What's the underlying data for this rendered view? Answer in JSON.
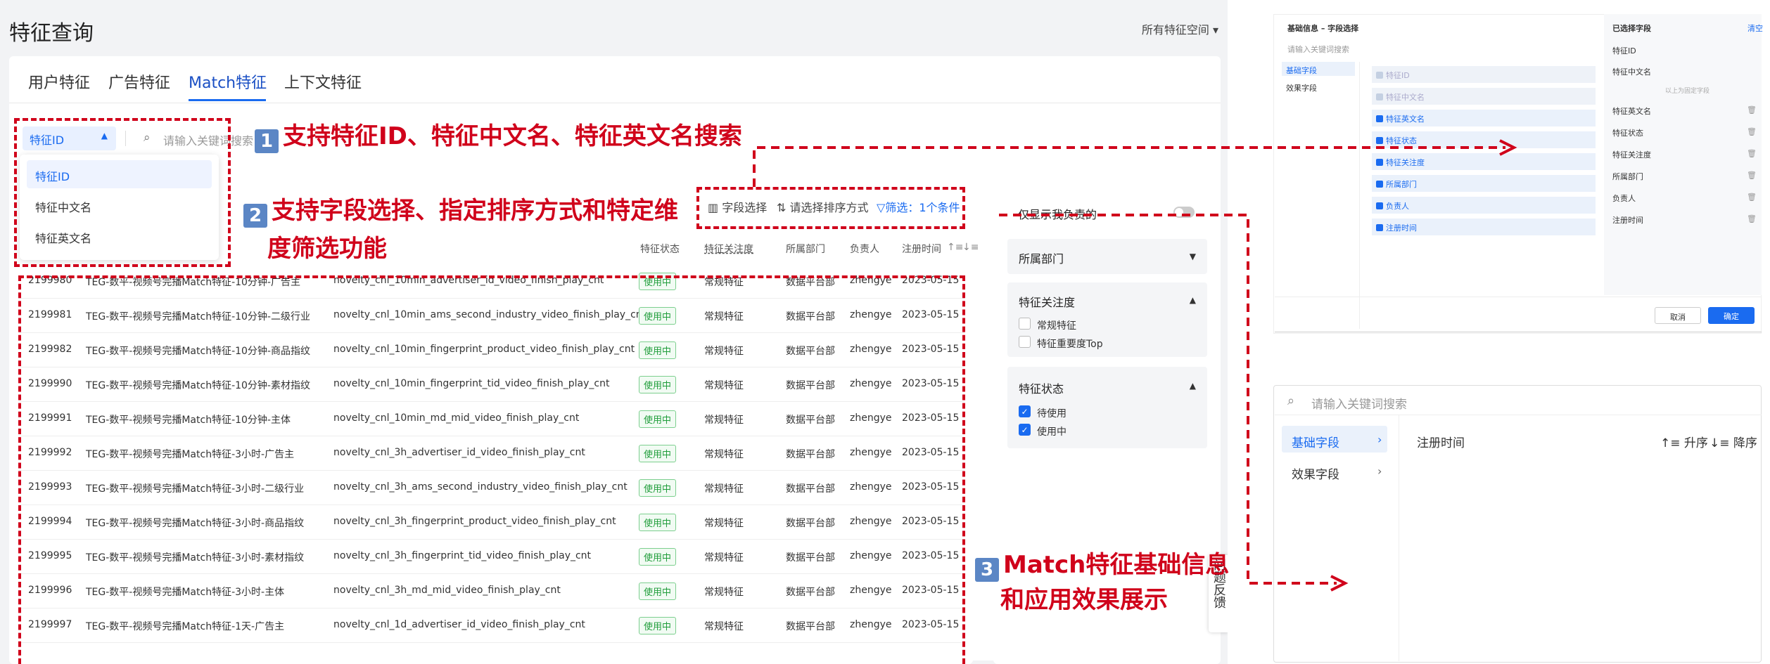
{
  "page": {
    "title": "特征查询",
    "space_selector": "所有特征空间 ▾"
  },
  "tabs": [
    {
      "label": "用户特征"
    },
    {
      "label": "广告特征"
    },
    {
      "label": "Match特征"
    },
    {
      "label": "上下文特征"
    }
  ],
  "search": {
    "field_selected": "特征ID",
    "placeholder": "请输入关键词搜索",
    "options": [
      "特征ID",
      "特征中文名",
      "特征英文名"
    ]
  },
  "toolbar": {
    "field_select": "字段选择",
    "sort": "请选择排序方式",
    "filter": "筛选：1个条件"
  },
  "annotations": {
    "a1_num": "1",
    "a1_text": "支持特征ID、特征中文名、特征英文名搜索",
    "a2_num": "2",
    "a2_line1": "支持字段选择、指定排序方式和特定维",
    "a2_line2": "度筛选功能",
    "a3_num": "3",
    "a3_line1": "Match特征基础信息",
    "a3_line2": "和应用效果展示"
  },
  "table": {
    "headers": {
      "status": "特征状态",
      "attention": "特征关注度",
      "dept": "所属部门",
      "owner": "负责人",
      "reg_time": "注册时间"
    },
    "rows": [
      {
        "id": "2199980",
        "cn": "TEG-数平-视频号完播Match特征-10分钟-广告主",
        "en": "novelty_cnl_10min_advertiser_id_video_finish_play_cnt",
        "status": "使用中",
        "attention": "常规特征",
        "dept": "数据平台部",
        "owner": "zhengye",
        "date": "2023-05-15"
      },
      {
        "id": "2199981",
        "cn": "TEG-数平-视频号完播Match特征-10分钟-二级行业",
        "en": "novelty_cnl_10min_ams_second_industry_video_finish_play_cnt",
        "status": "使用中",
        "attention": "常规特征",
        "dept": "数据平台部",
        "owner": "zhengye",
        "date": "2023-05-15"
      },
      {
        "id": "2199982",
        "cn": "TEG-数平-视频号完播Match特征-10分钟-商品指纹",
        "en": "novelty_cnl_10min_fingerprint_product_video_finish_play_cnt",
        "status": "使用中",
        "attention": "常规特征",
        "dept": "数据平台部",
        "owner": "zhengye",
        "date": "2023-05-15"
      },
      {
        "id": "2199990",
        "cn": "TEG-数平-视频号完播Match特征-10分钟-素材指纹",
        "en": "novelty_cnl_10min_fingerprint_tid_video_finish_play_cnt",
        "status": "使用中",
        "attention": "常规特征",
        "dept": "数据平台部",
        "owner": "zhengye",
        "date": "2023-05-15"
      },
      {
        "id": "2199991",
        "cn": "TEG-数平-视频号完播Match特征-10分钟-主体",
        "en": "novelty_cnl_10min_md_mid_video_finish_play_cnt",
        "status": "使用中",
        "attention": "常规特征",
        "dept": "数据平台部",
        "owner": "zhengye",
        "date": "2023-05-15"
      },
      {
        "id": "2199992",
        "cn": "TEG-数平-视频号完播Match特征-3小时-广告主",
        "en": "novelty_cnl_3h_advertiser_id_video_finish_play_cnt",
        "status": "使用中",
        "attention": "常规特征",
        "dept": "数据平台部",
        "owner": "zhengye",
        "date": "2023-05-15"
      },
      {
        "id": "2199993",
        "cn": "TEG-数平-视频号完播Match特征-3小时-二级行业",
        "en": "novelty_cnl_3h_ams_second_industry_video_finish_play_cnt",
        "status": "使用中",
        "attention": "常规特征",
        "dept": "数据平台部",
        "owner": "zhengye",
        "date": "2023-05-15"
      },
      {
        "id": "2199994",
        "cn": "TEG-数平-视频号完播Match特征-3小时-商品指纹",
        "en": "novelty_cnl_3h_fingerprint_product_video_finish_play_cnt",
        "status": "使用中",
        "attention": "常规特征",
        "dept": "数据平台部",
        "owner": "zhengye",
        "date": "2023-05-15"
      },
      {
        "id": "2199995",
        "cn": "TEG-数平-视频号完播Match特征-3小时-素材指纹",
        "en": "novelty_cnl_3h_fingerprint_tid_video_finish_play_cnt",
        "status": "使用中",
        "attention": "常规特征",
        "dept": "数据平台部",
        "owner": "zhengye",
        "date": "2023-05-15"
      },
      {
        "id": "2199996",
        "cn": "TEG-数平-视频号完播Match特征-3小时-主体",
        "en": "novelty_cnl_3h_md_mid_video_finish_play_cnt",
        "status": "使用中",
        "attention": "常规特征",
        "dept": "数据平台部",
        "owner": "zhengye",
        "date": "2023-05-15"
      },
      {
        "id": "2199997",
        "cn": "TEG-数平-视频号完播Match特征-1天-广告主",
        "en": "novelty_cnl_1d_advertiser_id_video_finish_play_cnt",
        "status": "使用中",
        "attention": "常规特征",
        "dept": "数据平台部",
        "owner": "zhengye",
        "date": "2023-05-15"
      }
    ]
  },
  "filters": {
    "only_mine": "仅显示我负责的",
    "dept_title": "所属部门",
    "attention_title": "特征关注度",
    "attention_opts": [
      "常规特征",
      "特征重要度Top"
    ],
    "status_title": "特征状态",
    "status_opts": [
      "待使用",
      "使用中"
    ]
  },
  "feedback": "问题反馈",
  "field_panel": {
    "title": "基础信息 – 字段选择",
    "search_ph": "请输入关键词搜索",
    "groups": [
      "基础字段",
      "效果字段"
    ],
    "fields": [
      "特征ID",
      "特征中文名",
      "特征英文名",
      "特征状态",
      "特征关注度",
      "所属部门",
      "负责人",
      "注册时间"
    ],
    "selected_title": "已选择字段",
    "clear": "清空",
    "selected_fixed": [
      "特征ID",
      "特征中文名"
    ],
    "fixed_note": "以上为固定字段",
    "selected_rest": [
      "特征英文名",
      "特征状态",
      "特征关注度",
      "所属部门",
      "负责人",
      "注册时间"
    ],
    "cancel": "取消",
    "confirm": "确定"
  },
  "sort_panel": {
    "search_ph": "请输入关键词搜索",
    "groups": [
      "基础字段",
      "效果字段"
    ],
    "field": "注册时间",
    "asc": "升序",
    "desc": "降序"
  },
  "colors": {
    "accent": "#1a6bf0",
    "annotation": "#d0021b",
    "status_green": "#1f9d3a"
  }
}
